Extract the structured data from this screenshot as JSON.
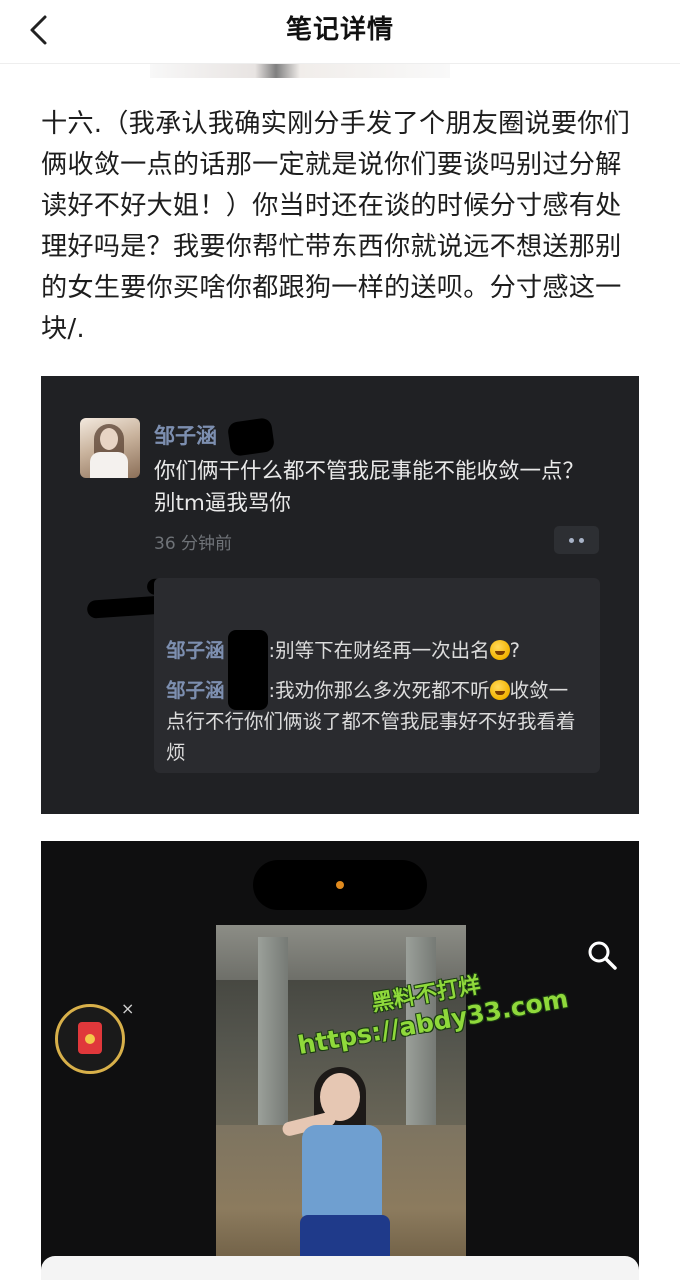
{
  "header": {
    "title": "笔记详情",
    "back_icon": "chevron-left-icon"
  },
  "article": {
    "text": "十六.（我承认我确实刚分手发了个朋友圈说要你们俩收敛一点的话那一定就是说你们要谈吗别过分解读好不好大姐！）你当时还在谈的时候分寸感有处理好吗是？我要你帮忙带东西你就说远不想送那别的女生要你买啥你都跟狗一样的送呗。分寸感这一块/."
  },
  "comment_screenshot": {
    "username": "邹子涵",
    "comment": "你们俩干什么都不管我屁事能不能收敛一点？别tm逼我骂你",
    "time": "36 分钟前",
    "replies": [
      {
        "name": "邹子涵",
        "text": ":别等下在财经再一次出名",
        "after_emoji": "?"
      },
      {
        "name": "邹子涵",
        "text": ":我劝你那么多次死都不听",
        "after_emoji": "收敛一点行不行你们俩谈了都不管我屁事好不好我看着烦"
      }
    ]
  },
  "video_screenshot": {
    "close_symbol": "×",
    "icons": [
      "search-icon",
      "red-packet-icon",
      "close-icon"
    ]
  },
  "watermark": {
    "line1": "黑料不打烊",
    "line2": "https://abdy33.com"
  },
  "colors": {
    "comment_bg": "#202124",
    "username_color": "#7d8fb0",
    "watermark_color": "#8fd93b"
  }
}
